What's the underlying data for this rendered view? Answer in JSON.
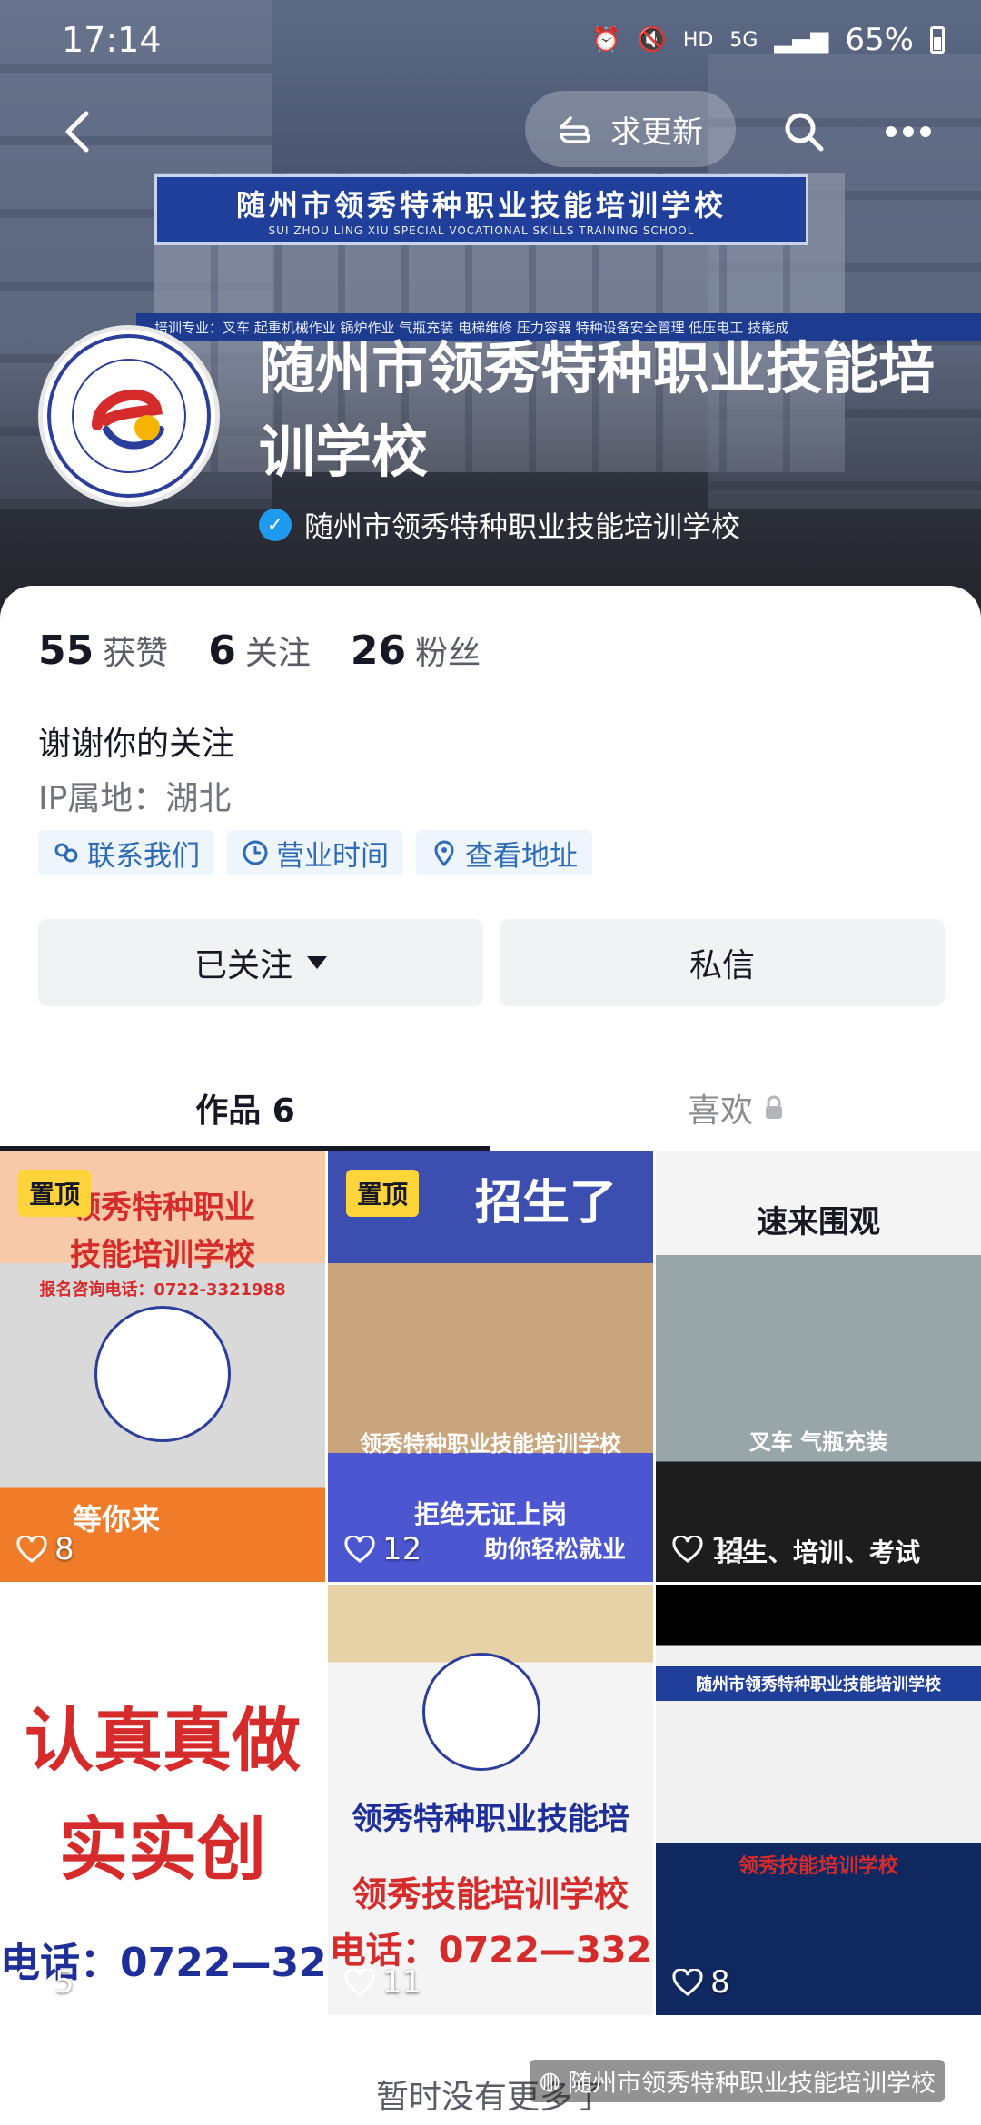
{
  "status": {
    "time": "17:14",
    "network": "HD",
    "signal": "5G",
    "battery": "65%"
  },
  "header": {
    "request_update_label": "求更新",
    "sign_cn": "随州市领秀特种职业技能培训学校",
    "sign_en": "SUI ZHOU LING XIU SPECIAL VOCATIONAL SKILLS TRAINING SCHOOL",
    "strip_text": "培训专业：叉车  起重机械作业  锅炉作业  气瓶充装  电梯维修  压力容器  特种设备安全管理  低压电工   技能成"
  },
  "profile": {
    "name": "随州市领秀特种职业技能培训学校",
    "verified_name": "随州市领秀特种职业技能培训学校",
    "stats": [
      {
        "num": "55",
        "label": "获赞"
      },
      {
        "num": "6",
        "label": "关注"
      },
      {
        "num": "26",
        "label": "粉丝"
      }
    ],
    "bio": "谢谢你的关注",
    "ip": "IP属地：湖北",
    "chips": [
      "联系我们",
      "营业时间",
      "查看地址"
    ],
    "follow_label": "已关注",
    "message_label": "私信"
  },
  "tabs": {
    "works": "作品 6",
    "likes": "喜欢"
  },
  "videos": [
    {
      "pinned": "置顶",
      "likes": "8",
      "line1": "领秀特种职业",
      "line2": "技能培训学校",
      "line3": "报名咨询电话：0722-3321988",
      "line4": "等你来"
    },
    {
      "pinned": "置顶",
      "likes": "12",
      "line1": "招生了",
      "line2": "领秀特种职业技能培训学校",
      "line3": "拒绝无证上岗",
      "line4": "助你轻松就业"
    },
    {
      "likes": "11",
      "line1": "速来围观",
      "line2": "叉车  气瓶充装",
      "line3": "招生、培训、考试"
    },
    {
      "likes": "5",
      "line1": "认真真做",
      "line2": "实实创",
      "line3": "电话：0722—32"
    },
    {
      "likes": "11",
      "line1": "领秀特种职业技能培",
      "line2": "领秀技能培训学校",
      "line3": "电话：0722—332"
    },
    {
      "likes": "8",
      "line1": "随州市领秀特种职业技能培训学校",
      "line2": "领秀技能培训学校"
    }
  ],
  "footer": {
    "note": "暂时没有更多了",
    "watermark": "随州市领秀特种职业技能培训学校"
  },
  "colors": {
    "accent_blue": "#2d6bb7",
    "verified": "#1e9bf0",
    "pin": "#ffd43b"
  }
}
